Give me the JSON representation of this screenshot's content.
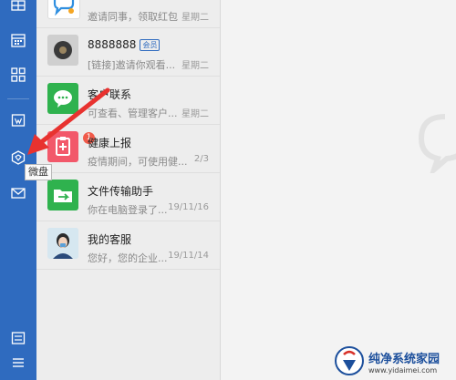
{
  "tooltip": "微盘",
  "conversations": [
    {
      "name": "",
      "preview": "邀请同事，领取红包",
      "time": "星期二",
      "icon": "chat-bubble-logo-icon"
    },
    {
      "name": "8888888",
      "badge": "会员",
      "preview": "[链接]邀请你观看...",
      "time": "星期二",
      "icon": "user-avatar-icon"
    },
    {
      "name": "客户联系",
      "preview": "可查看、管理客户...",
      "time": "星期二",
      "icon": "wechat-contact-icon"
    },
    {
      "name": "健康上报",
      "preview": "疫情期间，可使用健...",
      "time": "2/3",
      "icon": "health-report-icon",
      "unread": "1"
    },
    {
      "name": "文件传输助手",
      "preview": "你在电脑登录了...",
      "time": "19/11/16",
      "icon": "file-transfer-icon"
    },
    {
      "name": "我的客服",
      "preview": "您好，您的企业...",
      "time": "19/11/14",
      "icon": "customer-service-avatar"
    }
  ],
  "watermark": {
    "title": "纯净系统家园",
    "url": "www.yidaimei.com"
  },
  "colors": {
    "rail": "#2f6bbf",
    "accent_red": "#e8322f"
  }
}
